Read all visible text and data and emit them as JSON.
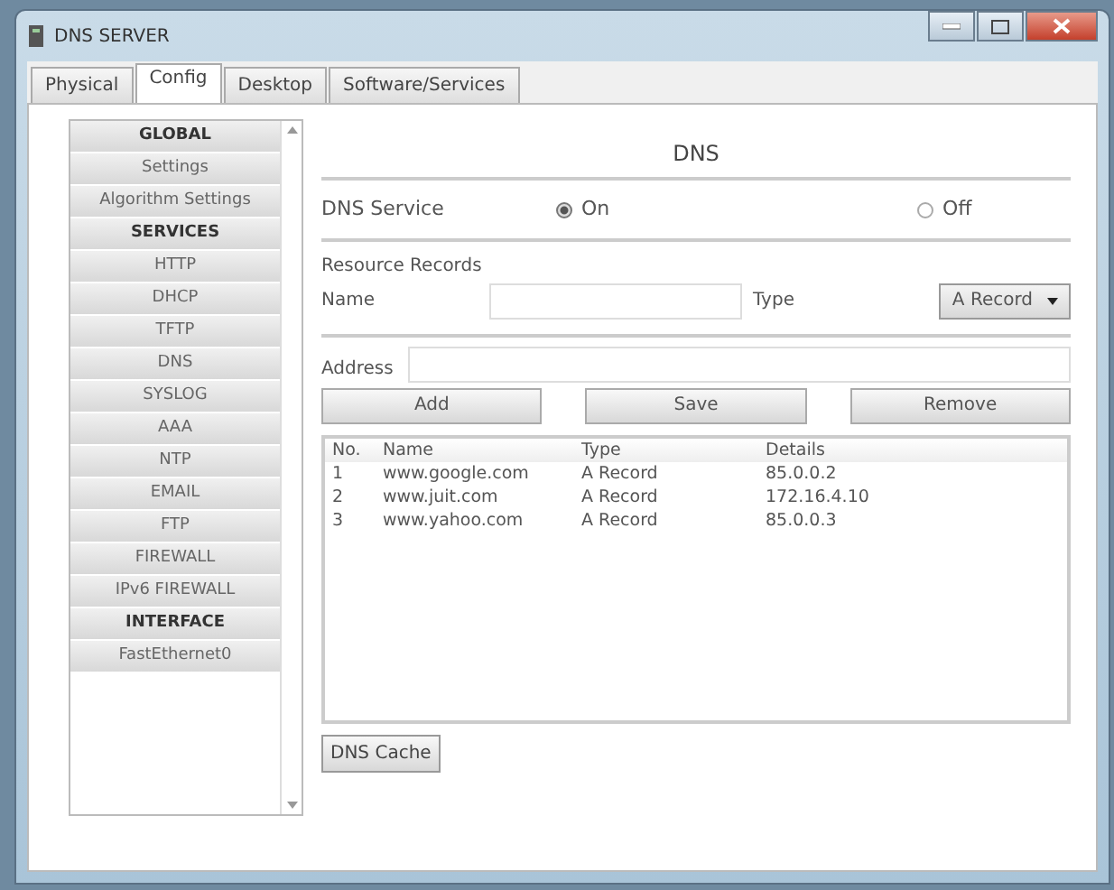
{
  "window": {
    "title": "DNS SERVER"
  },
  "tabs": [
    {
      "label": "Physical",
      "selected": false
    },
    {
      "label": "Config",
      "selected": true
    },
    {
      "label": "Desktop",
      "selected": false
    },
    {
      "label": "Software/Services",
      "selected": false
    }
  ],
  "sidebar": {
    "items": [
      {
        "label": "GLOBAL",
        "kind": "header"
      },
      {
        "label": "Settings",
        "kind": "item"
      },
      {
        "label": "Algorithm Settings",
        "kind": "item"
      },
      {
        "label": "SERVICES",
        "kind": "header"
      },
      {
        "label": "HTTP",
        "kind": "item"
      },
      {
        "label": "DHCP",
        "kind": "item"
      },
      {
        "label": "TFTP",
        "kind": "item"
      },
      {
        "label": "DNS",
        "kind": "item"
      },
      {
        "label": "SYSLOG",
        "kind": "item"
      },
      {
        "label": "AAA",
        "kind": "item"
      },
      {
        "label": "NTP",
        "kind": "item"
      },
      {
        "label": "EMAIL",
        "kind": "item"
      },
      {
        "label": "FTP",
        "kind": "item"
      },
      {
        "label": "FIREWALL",
        "kind": "item"
      },
      {
        "label": "IPv6 FIREWALL",
        "kind": "item"
      },
      {
        "label": "INTERFACE",
        "kind": "header"
      },
      {
        "label": "FastEthernet0",
        "kind": "item"
      }
    ]
  },
  "panel": {
    "title": "DNS",
    "service": {
      "label": "DNS Service",
      "options": [
        {
          "label": "On",
          "checked": true
        },
        {
          "label": "Off",
          "checked": false
        }
      ]
    },
    "records_heading": "Resource Records",
    "name_label": "Name",
    "type_label": "Type",
    "type_value": "A Record",
    "address_label": "Address",
    "buttons": [
      "Add",
      "Save",
      "Remove"
    ],
    "table": {
      "columns": [
        "No.",
        "Name",
        "Type",
        "Details"
      ],
      "rows": [
        [
          "1",
          "www.google.com",
          "A Record",
          "85.0.0.2"
        ],
        [
          "2",
          "www.juit.com",
          "A Record",
          "172.16.4.10"
        ],
        [
          "3",
          "www.yahoo.com",
          "A Record",
          "85.0.0.3"
        ]
      ]
    },
    "cache_button": "DNS Cache"
  }
}
